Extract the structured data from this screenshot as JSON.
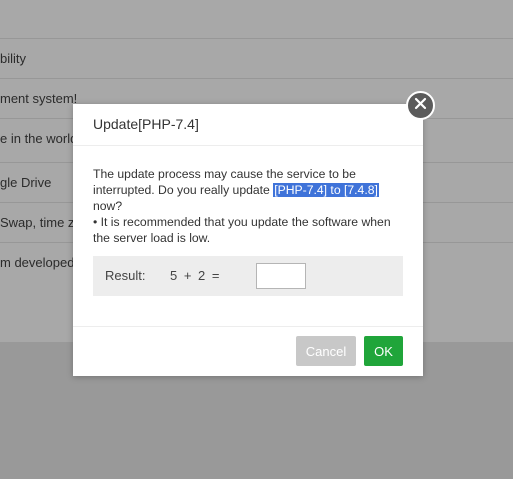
{
  "background": {
    "rows": [
      "bility",
      "ment system!",
      "e in the world",
      "gle Drive",
      "Swap, time z",
      "m developed"
    ]
  },
  "dialog": {
    "title": "Update[PHP-7.4]",
    "message_before": "The update process may cause the service to be interrupted. Do you really update ",
    "message_highlight": "[PHP-7.4] to [7.4.8]",
    "message_after": " now?",
    "bullet": "•   It is recommended that you update the software when the server load is low.",
    "result_label": "Result:",
    "result_expression": "5 + 2  =",
    "result_value": "",
    "cancel_label": "Cancel",
    "ok_label": "OK",
    "close_icon": "close-icon"
  },
  "colors": {
    "ok": "#20a53a",
    "cancel": "#c8c8c8",
    "highlight": "#3f73d9",
    "overlay": "#a8a8a8"
  }
}
